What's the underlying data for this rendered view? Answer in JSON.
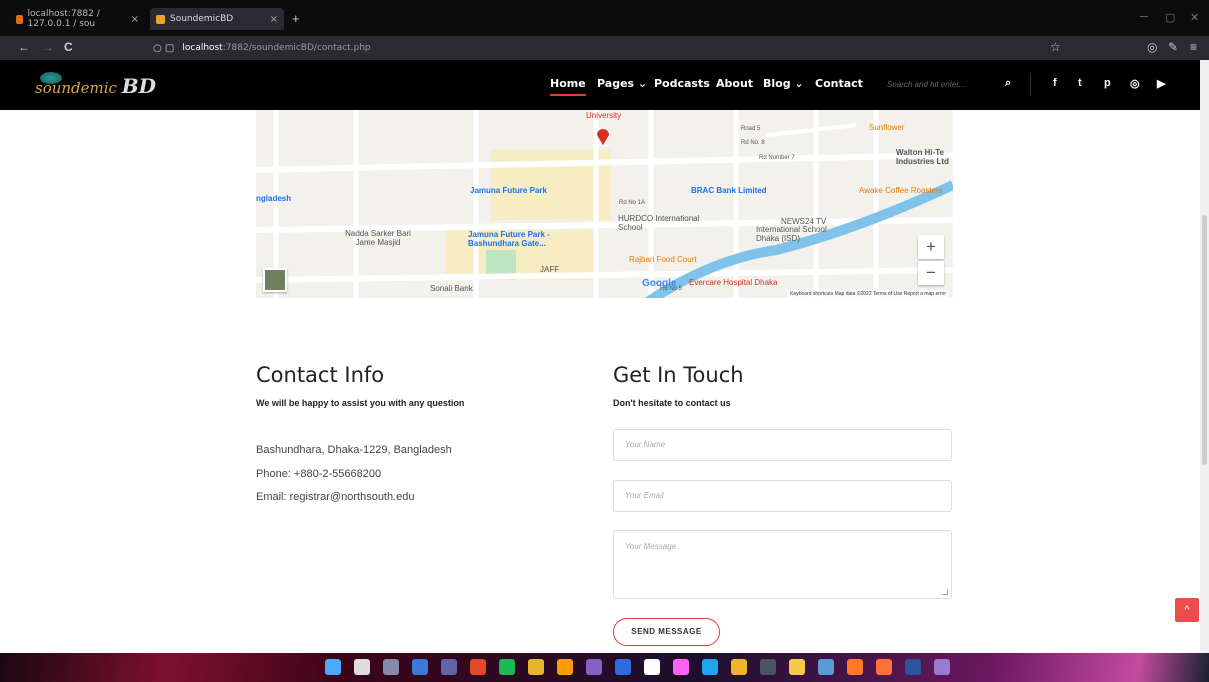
{
  "browser": {
    "tabs": [
      {
        "label": "localhost:7882 / 127.0.0.1 / sou",
        "color": "#e06d1c"
      },
      {
        "label": "SoundemicBD",
        "color": "#e9a52a"
      }
    ],
    "close_glyph": "×",
    "new_tab_glyph": "+",
    "url_host": "localhost",
    "url_path": ":7882/soundemicBD/contact.php",
    "nav_glyphs": {
      "back": "←",
      "forward": "→",
      "reload": "C"
    },
    "window_glyphs": {
      "minimize": "─",
      "restore": "▢",
      "close": "✕"
    },
    "toolbar_glyphs": {
      "star": "☆",
      "pocket": "◎",
      "menu": "≡"
    }
  },
  "site": {
    "logo_script": "soundemic",
    "logo_suffix": "BD",
    "nav": [
      {
        "label": "Home",
        "active": true
      },
      {
        "label": "Pages ⌄"
      },
      {
        "label": "Podcasts"
      },
      {
        "label": "About"
      },
      {
        "label": "Blog ⌄"
      },
      {
        "label": "Contact"
      }
    ],
    "search_placeholder": "Search and hit enter...",
    "search_glyph": "⌕",
    "social": [
      "f",
      "t",
      "p",
      "◎",
      "▶"
    ],
    "accent": "#e53935"
  },
  "map": {
    "labels": [
      {
        "text": "University",
        "class": "red"
      },
      {
        "text": "Sunflower",
        "class": "orange"
      },
      {
        "text": "Walton Hi-Te Industries Ltd",
        "class": ""
      },
      {
        "text": "Jamuna Future Park",
        "class": "blue"
      },
      {
        "text": "BRAC Bank Limited",
        "class": "blue"
      },
      {
        "text": "Awake Coffee Roasters",
        "class": "orange"
      },
      {
        "text": "ngladesh",
        "class": "blue"
      },
      {
        "text": "HURDCO International School",
        "class": ""
      },
      {
        "text": "NEWS24 TV",
        "class": ""
      },
      {
        "text": "International School Dhaka (ISD)",
        "class": ""
      },
      {
        "text": "Nadda Sarker Bari Jame Masjid",
        "class": ""
      },
      {
        "text": "Jamuna Future Park - Bashundhara Gate...",
        "class": "blue"
      },
      {
        "text": "Rajbari Food Court",
        "class": "orange"
      },
      {
        "text": "JAFF",
        "class": ""
      },
      {
        "text": "Sonali Bank",
        "class": ""
      },
      {
        "text": "Evercare Hospital Dhaka",
        "class": "red"
      },
      {
        "text": "Road 5",
        "class": ""
      },
      {
        "text": "Rd No. 8",
        "class": ""
      },
      {
        "text": "Rd Number 7",
        "class": ""
      },
      {
        "text": "Rd No 1A",
        "class": ""
      },
      {
        "text": "Rd No 5",
        "class": ""
      }
    ],
    "google": "Google",
    "zoom_in": "+",
    "zoom_out": "−",
    "footer": "Keyboard shortcuts   Map data ©2022   Terms of Use   Report a map error"
  },
  "contact_info": {
    "title": "Contact Info",
    "subtitle": "We will be happy to assist you with any question",
    "address": "Bashundhara, Dhaka-1229, Bangladesh",
    "phone": "Phone: +880-2-55668200",
    "email": "Email: registrar@northsouth.edu"
  },
  "form": {
    "title": "Get In Touch",
    "subtitle": "Don't hesitate to contact us",
    "name_placeholder": "Your Name",
    "email_placeholder": "Your Email",
    "message_placeholder": "Your Message",
    "send_label": "SEND MESSAGE"
  },
  "back_to_top_glyph": "^",
  "taskbar": {
    "icons": [
      {
        "name": "windows-start-icon",
        "color": "#4aa8ff"
      },
      {
        "name": "search-icon",
        "color": "#dddddd"
      },
      {
        "name": "task-view-icon",
        "color": "#8888aa"
      },
      {
        "name": "widgets-icon",
        "color": "#3b7bd6"
      },
      {
        "name": "teams-chat-icon",
        "color": "#6264a7"
      },
      {
        "name": "app-icon",
        "color": "#e04a2a"
      },
      {
        "name": "spotify-icon",
        "color": "#1db954"
      },
      {
        "name": "chrome-icon",
        "color": "#e8b32d"
      },
      {
        "name": "illustrator-icon",
        "color": "#ff9a00"
      },
      {
        "name": "vs-icon",
        "color": "#865fc5"
      },
      {
        "name": "app2-icon",
        "color": "#2d6cdf"
      },
      {
        "name": "app3-icon",
        "color": "#ffffff"
      },
      {
        "name": "xd-icon",
        "color": "#ff61f6"
      },
      {
        "name": "vscode-icon",
        "color": "#22a5f1"
      },
      {
        "name": "chrome2-icon",
        "color": "#f0b429"
      },
      {
        "name": "terminal-icon",
        "color": "#4c5563"
      },
      {
        "name": "explorer-icon",
        "color": "#f7c948"
      },
      {
        "name": "calculator-icon",
        "color": "#5b9bd5"
      },
      {
        "name": "xampp-icon",
        "color": "#fb7a24"
      },
      {
        "name": "firefox-icon",
        "color": "#ff7139"
      },
      {
        "name": "word-icon",
        "color": "#2b579a"
      },
      {
        "name": "photos-icon",
        "color": "#9a7bd1"
      }
    ]
  }
}
